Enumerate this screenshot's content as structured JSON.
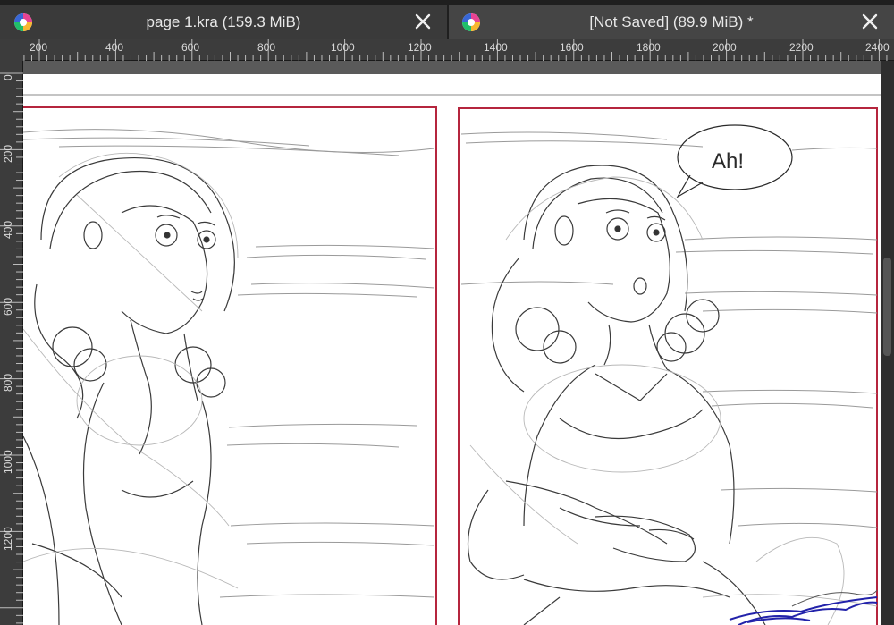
{
  "tabs": [
    {
      "title": "page 1.kra (159.3 MiB)",
      "icon": "krita-logo-icon",
      "active": false
    },
    {
      "title": "[Not Saved]  (89.9 MiB) *",
      "icon": "krita-logo-icon",
      "active": true
    }
  ],
  "ruler_top": {
    "labels": [
      "200",
      "400",
      "600",
      "800",
      "1000",
      "1200",
      "1400",
      "1600",
      "1800",
      "2000",
      "2200",
      "2400"
    ]
  },
  "ruler_left": {
    "labels": [
      "0",
      "200",
      "400",
      "600",
      "800",
      "1000",
      "1200"
    ]
  },
  "canvas": {
    "speech_bubble_text": "Ah!",
    "panel_border_color": "#b5253d",
    "background_color": "#5a5a5a"
  }
}
